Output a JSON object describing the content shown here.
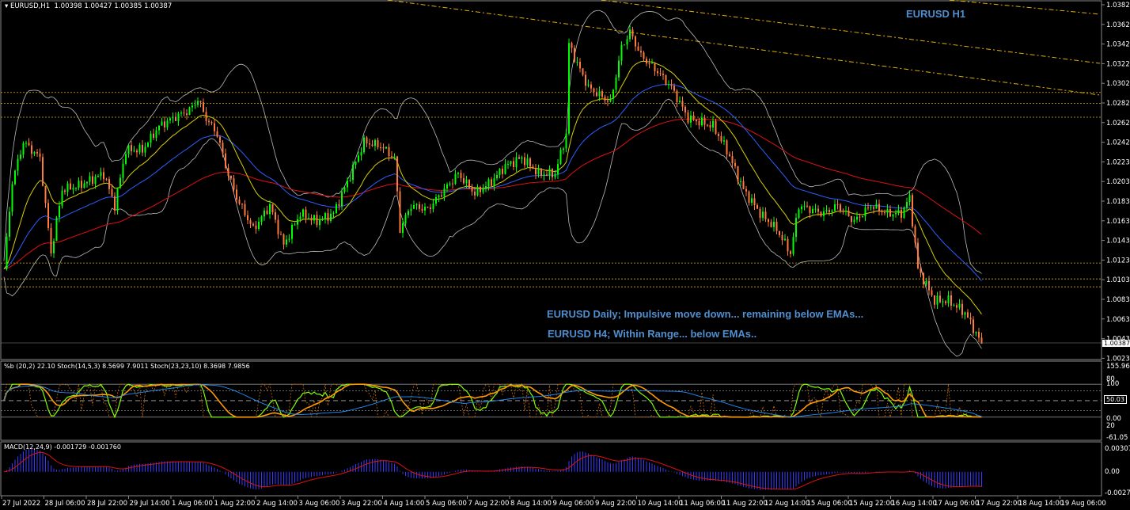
{
  "header": {
    "symbol": "EURUSD,H1",
    "ohlc": "1.00398 1.00427 1.00385 1.00387"
  },
  "annotations": {
    "title": "EURUSD H1",
    "daily": "EURUSD Daily; Impulsive move down... remaining below EMAs...",
    "h4": "EURUSD H4; Within Range... below EMAs.."
  },
  "price_axis": [
    "1.03820",
    "1.03625",
    "1.03425",
    "1.03225",
    "1.03025",
    "1.02825",
    "1.02625",
    "1.02425",
    "1.02230",
    "1.02030",
    "1.01830",
    "1.01630",
    "1.01430",
    "1.01230",
    "1.01030",
    "1.00835",
    "1.00635",
    "1.00435",
    "1.00235"
  ],
  "current_price": "1.00387",
  "stoch_panel": {
    "label": "%b (20,2) 22.10  Stoch(14,5,3) 8.5699 7.9011  Stoch(23,23,10) 8.3698 7.9856",
    "axis": [
      "155.96",
      "80",
      "100",
      "50.03",
      "0.00",
      "20",
      "-61.05"
    ]
  },
  "macd_panel": {
    "label": "MACD(12,24,9) -0.001729 -0.001760",
    "axis": [
      "0.003075",
      "0.00",
      "-0.002708"
    ]
  },
  "time_axis": [
    "27 Jul 2022",
    "28 Jul 06:00",
    "28 Jul 22:00",
    "29 Jul 14:00",
    "1 Aug 06:00",
    "1 Aug 22:00",
    "2 Aug 14:00",
    "3 Aug 06:00",
    "3 Aug 22:00",
    "4 Aug 14:00",
    "5 Aug 06:00",
    "7 Aug 22:00",
    "8 Aug 14:00",
    "9 Aug 06:00",
    "9 Aug 22:00",
    "10 Aug 14:00",
    "11 Aug 06:00",
    "11 Aug 22:00",
    "12 Aug 14:00",
    "15 Aug 06:00",
    "15 Aug 22:00",
    "16 Aug 14:00",
    "17 Aug 06:00",
    "17 Aug 22:00",
    "18 Aug 14:00",
    "19 Aug 06:00"
  ],
  "colors": {
    "bull": "#00ff00",
    "bear": "#ff7a3d",
    "ema_fast": "#2b5fff",
    "ema_slow": "#e01010",
    "level": "#e0b000",
    "annotation": "#4f8fd0"
  },
  "chart_data": {
    "type": "candlestick",
    "title": "EURUSD,H1",
    "ylim": [
      1.00235,
      1.0382
    ],
    "key_closes": [
      [
        0,
        1.0114
      ],
      [
        3,
        1.0202
      ],
      [
        7,
        1.0242
      ],
      [
        13,
        1.0226
      ],
      [
        17,
        1.013
      ],
      [
        21,
        1.0194
      ],
      [
        27,
        1.0198
      ],
      [
        36,
        1.021
      ],
      [
        40,
        1.0178
      ],
      [
        44,
        1.0234
      ],
      [
        50,
        1.0234
      ],
      [
        56,
        1.0258
      ],
      [
        61,
        1.0266
      ],
      [
        67,
        1.0274
      ],
      [
        70,
        1.0285
      ],
      [
        73,
        1.0266
      ],
      [
        77,
        1.025
      ],
      [
        80,
        1.0218
      ],
      [
        84,
        1.0186
      ],
      [
        90,
        1.0154
      ],
      [
        96,
        1.0178
      ],
      [
        101,
        1.0138
      ],
      [
        107,
        1.017
      ],
      [
        113,
        1.0162
      ],
      [
        119,
        1.017
      ],
      [
        124,
        1.0202
      ],
      [
        130,
        1.0242
      ],
      [
        136,
        1.0238
      ],
      [
        141,
        1.0226
      ],
      [
        143,
        1.0154
      ],
      [
        147,
        1.0178
      ],
      [
        153,
        1.0174
      ],
      [
        159,
        1.0194
      ],
      [
        164,
        1.021
      ],
      [
        170,
        1.019
      ],
      [
        176,
        1.0202
      ],
      [
        181,
        1.0218
      ],
      [
        187,
        1.0226
      ],
      [
        193,
        1.021
      ],
      [
        199,
        1.021
      ],
      [
        203,
        1.025
      ],
      [
        204,
        1.0341
      ],
      [
        207,
        1.0321
      ],
      [
        211,
        1.0297
      ],
      [
        219,
        1.0282
      ],
      [
        223,
        1.0337
      ],
      [
        226,
        1.0353
      ],
      [
        230,
        1.0329
      ],
      [
        236,
        1.0313
      ],
      [
        241,
        1.0297
      ],
      [
        247,
        1.0266
      ],
      [
        256,
        1.0258
      ],
      [
        261,
        1.0234
      ],
      [
        267,
        1.0194
      ],
      [
        273,
        1.017
      ],
      [
        279,
        1.0154
      ],
      [
        284,
        1.013
      ],
      [
        287,
        1.0178
      ],
      [
        296,
        1.017
      ],
      [
        301,
        1.0178
      ],
      [
        307,
        1.0162
      ],
      [
        313,
        1.0178
      ],
      [
        319,
        1.017
      ],
      [
        324,
        1.017
      ],
      [
        327,
        1.0186
      ],
      [
        330,
        1.0114
      ],
      [
        336,
        1.0082
      ],
      [
        341,
        1.0082
      ],
      [
        347,
        1.007
      ],
      [
        353,
        1.00387
      ]
    ],
    "horizontal_levels": [
      1.0292,
      1.0281,
      1.0267,
      1.012,
      1.0104,
      1.0096
    ],
    "stoch_range": [
      -61.05,
      155.96
    ],
    "macd_range": [
      -0.002708,
      0.003075
    ]
  }
}
